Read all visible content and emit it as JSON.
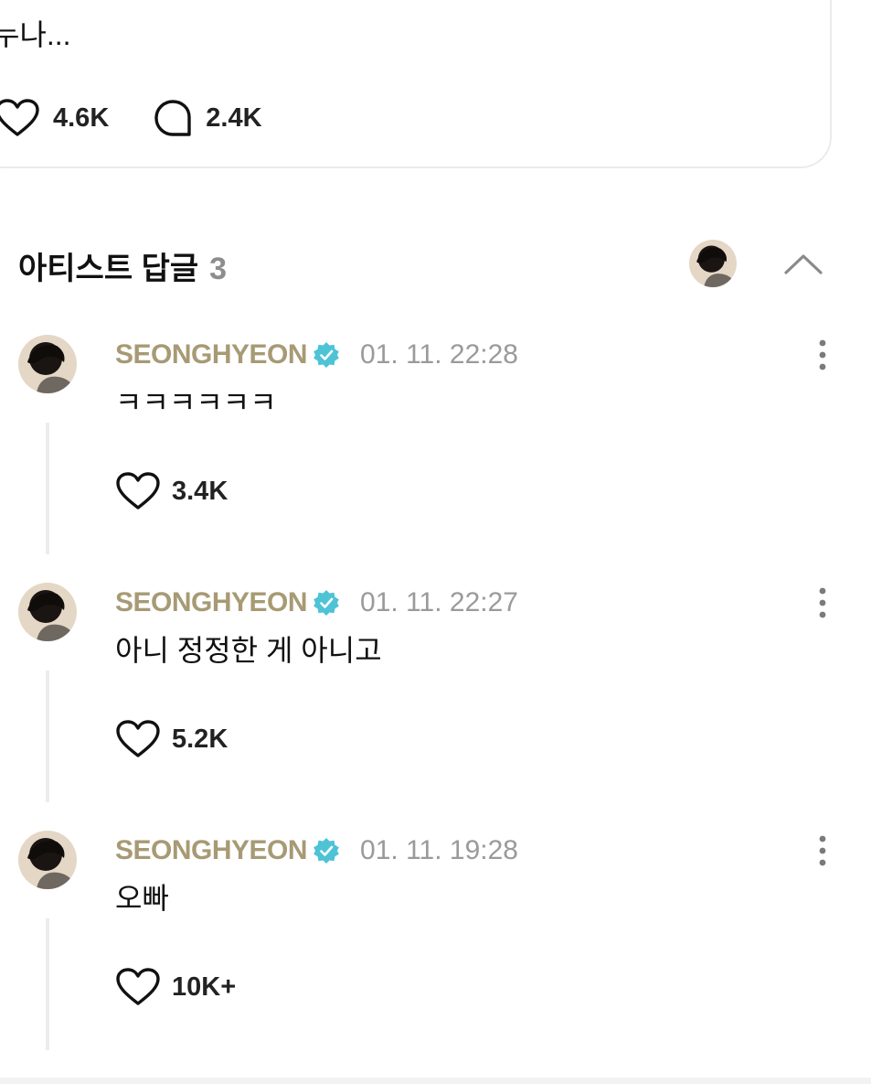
{
  "post": {
    "text": "누나...",
    "likes": "4.6K",
    "comments": "2.4K"
  },
  "artist_replies": {
    "title": "아티스트 답글",
    "count": "3"
  },
  "replies": [
    {
      "author": "SEONGHYEON",
      "date": "01. 11. 22:28",
      "text": "ㅋㅋㅋㅋㅋㅋ",
      "likes": "3.4K"
    },
    {
      "author": "SEONGHYEON",
      "date": "01. 11. 22:27",
      "text": "아니 정정한 게 아니고",
      "likes": "5.2K"
    },
    {
      "author": "SEONGHYEON",
      "date": "01. 11. 19:28",
      "text": "오빠",
      "likes": "10K+"
    }
  ],
  "colors": {
    "author": "#a79a74",
    "verified_badge": "#4ec3d6",
    "muted": "#9a9a9a"
  },
  "icons": [
    "heart-icon",
    "comment-icon",
    "chevron-up-icon",
    "verified-badge-icon",
    "more-vertical-icon"
  ]
}
